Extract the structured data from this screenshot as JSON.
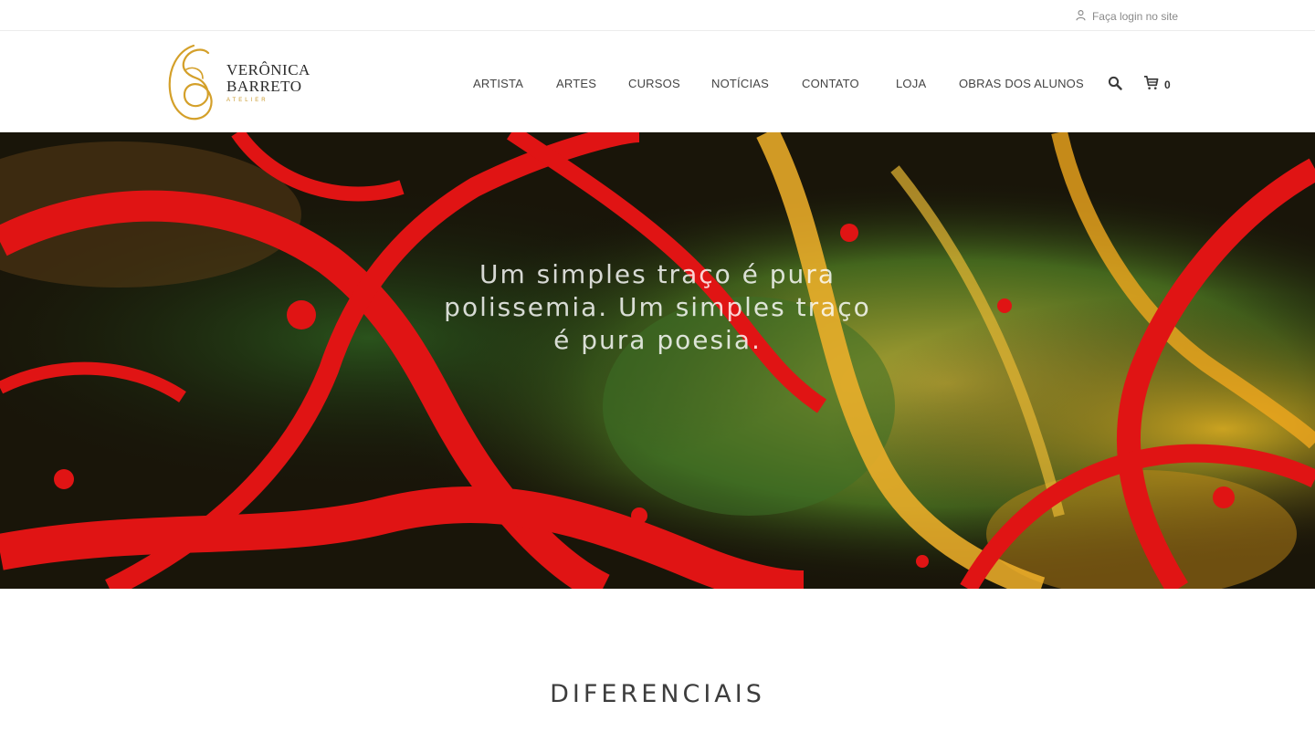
{
  "topbar": {
    "login_label": "Faça login no site",
    "login_icon": "user-icon"
  },
  "brand": {
    "name_line1": "VERÔNICA",
    "name_line2": "BARRETO",
    "name_line3": "ATELIER",
    "accent_color": "#d4a02a"
  },
  "nav": {
    "items": [
      {
        "label": "ARTISTA"
      },
      {
        "label": "ARTES"
      },
      {
        "label": "CURSOS"
      },
      {
        "label": "NOTÍCIAS"
      },
      {
        "label": "CONTATO"
      },
      {
        "label": "LOJA"
      },
      {
        "label": "OBRAS DOS ALUNOS"
      }
    ],
    "search_icon": "search-icon",
    "cart_icon": "cart-icon",
    "cart_count": "0"
  },
  "hero": {
    "quote": "Um simples traço é pura polissemia. Um simples traço é pura poesia.",
    "colors": {
      "red": "#e01414",
      "yellow": "#f2c419",
      "green": "#3f7d2a",
      "dark": "#14110a"
    }
  },
  "section": {
    "title": "DIFERENCIAIS"
  }
}
